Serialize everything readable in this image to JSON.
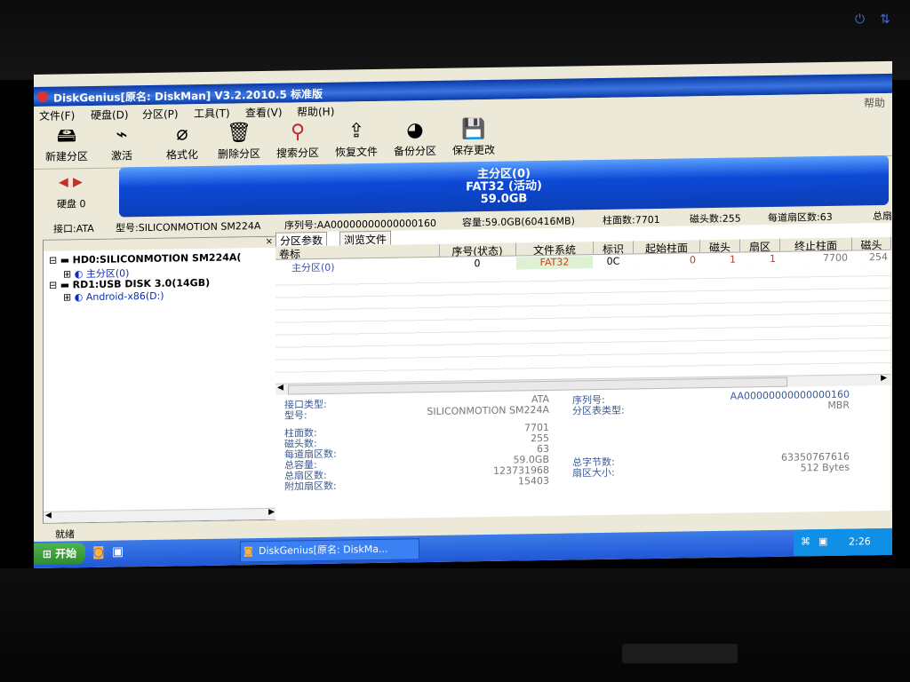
{
  "window": {
    "title": "DiskGenius[原名: DiskMan] V3.2.2010.5 标准版"
  },
  "menu": {
    "items": [
      "文件(F)",
      "硬盘(D)",
      "分区(P)",
      "工具(T)",
      "查看(V)",
      "帮助(H)"
    ],
    "help_right": "帮助"
  },
  "toolbar": {
    "buttons": [
      {
        "label": "新建分区",
        "icon": "new-partition-icon"
      },
      {
        "label": "激活",
        "icon": "activate-icon"
      },
      {
        "label": "格式化",
        "icon": "format-icon"
      },
      {
        "label": "删除分区",
        "icon": "delete-partition-icon"
      },
      {
        "label": "搜索分区",
        "icon": "search-partition-icon"
      },
      {
        "label": "恢复文件",
        "icon": "recover-files-icon"
      },
      {
        "label": "备份分区",
        "icon": "backup-partition-icon"
      },
      {
        "label": "保存更改",
        "icon": "save-changes-icon"
      }
    ]
  },
  "disk_nav": {
    "label": "硬盘 0"
  },
  "partition_bar": {
    "name": "主分区(0)",
    "fs": "FAT32 (活动)",
    "size": "59.0GB",
    "color": "#0d49d6"
  },
  "disk_info": {
    "interface": "接口:ATA",
    "model": "型号:SILICONMOTION SM224A",
    "serial": "序列号:AA00000000000000160",
    "capacity": "容量:59.0GB(60416MB)",
    "cylinders": "柱面数:7701",
    "heads": "磁头数:255",
    "sectors": "每道扇区数:63",
    "total": "总扇"
  },
  "tree": {
    "items": [
      {
        "text": "HD0:SILICONMOTION SM224A(",
        "level": 0
      },
      {
        "text": "主分区(0)",
        "level": 1
      },
      {
        "text": "RD1:USB DISK 3.0(14GB)",
        "level": 0
      },
      {
        "text": "Android-x86(D:)",
        "level": 1
      }
    ]
  },
  "tabs": [
    "分区参数",
    "浏览文件"
  ],
  "table": {
    "headers": [
      "卷标",
      "序号(状态)",
      "文件系统",
      "标识",
      "起始柱面",
      "磁头",
      "扇区",
      "终止柱面",
      "磁头"
    ],
    "row": [
      "主分区(0)",
      "0",
      "FAT32",
      "0C",
      "0",
      "1",
      "1",
      "7700",
      "254"
    ]
  },
  "details": {
    "left": [
      {
        "label": "接口类型:",
        "value": "ATA"
      },
      {
        "label": "型号:",
        "value": "SILICONMOTION SM224A"
      },
      {
        "label": "柱面数:",
        "value": "7701"
      },
      {
        "label": "磁头数:",
        "value": "255"
      },
      {
        "label": "每道扇区数:",
        "value": "63"
      },
      {
        "label": "总容量:",
        "value": "59.0GB"
      },
      {
        "label": "总扇区数:",
        "value": "123731968"
      },
      {
        "label": "附加扇区数:",
        "value": "15403"
      }
    ],
    "right": [
      {
        "label": "序列号:",
        "value": "AA00000000000000160"
      },
      {
        "label": "分区表类型:",
        "value": "MBR"
      },
      {
        "label": "总字节数:",
        "value": "63350767616"
      },
      {
        "label": "扇区大小:",
        "value": "512 Bytes"
      }
    ]
  },
  "status": {
    "text": "就绪"
  },
  "taskbar": {
    "start": "开始",
    "task": "DiskGenius[原名: DiskMa...",
    "clock": "2:26"
  }
}
